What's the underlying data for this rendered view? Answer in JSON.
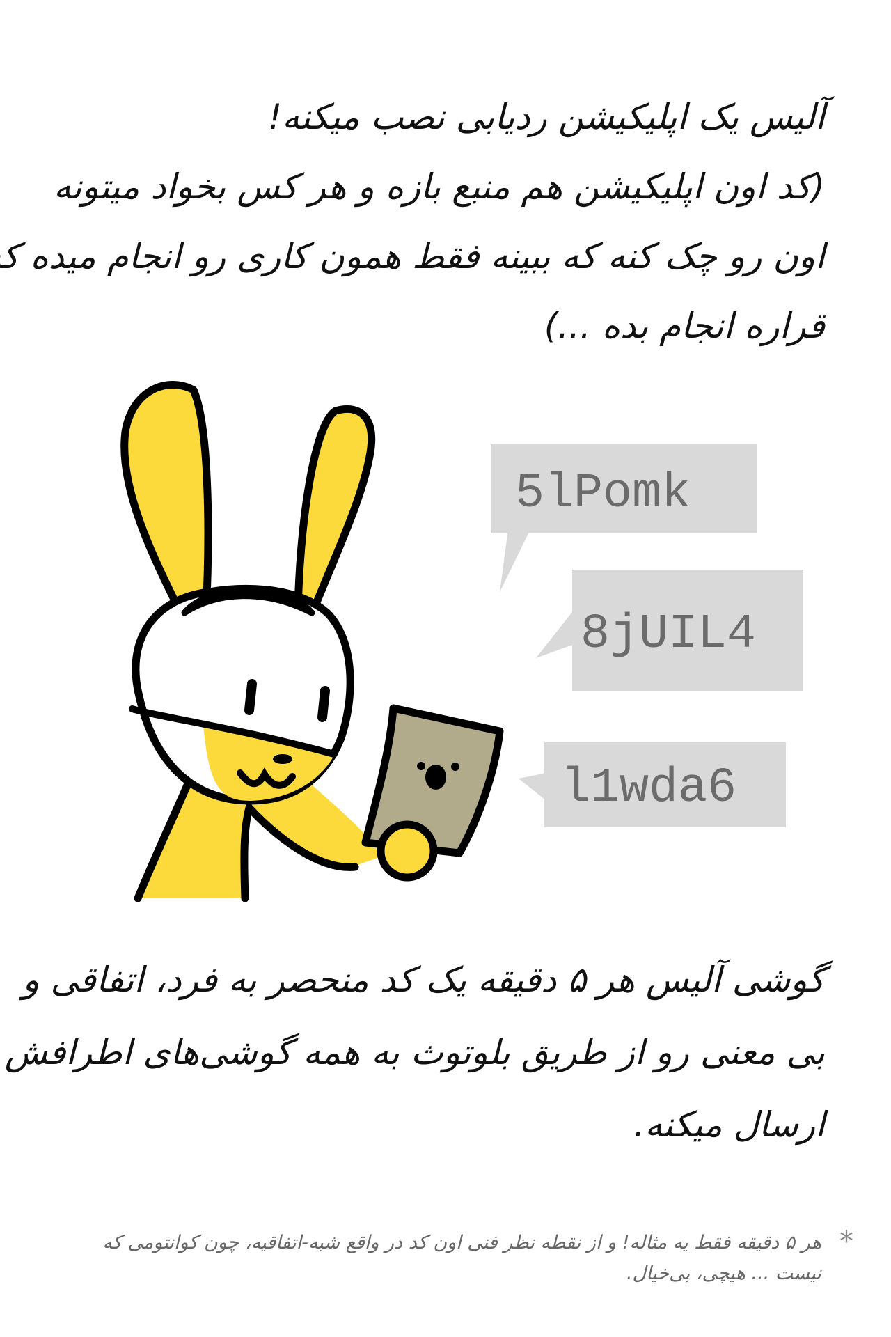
{
  "intro": {
    "lines": [
      "آلیس یک اپلیکیشن ردیابی نصب میکنه!",
      "(کد اون اپلیکیشن هم منبع بازه و هر کس بخواد میتونه",
      "اون رو چک کنه که ببینه فقط همون کاری رو انجام میده که",
      "قراره انجام بده ...)"
    ]
  },
  "codes": [
    "5lPomk",
    "8jUIL4",
    "l1wda6"
  ],
  "body": {
    "lines": [
      "گوشی آلیس هر ۵ دقیقه یک کد منحصر به فرد، اتفاقی و",
      "بی معنی رو از طریق بلوتوث به همه گوشی‌های اطرافش",
      "ارسال میکنه."
    ]
  },
  "footnote": {
    "asterisk": "*",
    "lines": [
      "هر ۵ دقیقه فقط یه مثاله! و از نقطه نظر فنی اون کد در واقع شبه-اتفاقیه، چون کوانتومی که",
      "نیست ... هیچی، بی‌خیال."
    ]
  },
  "colors": {
    "bunny_yellow": "#FDDA3B",
    "phone_body": "#B1AA8B",
    "bubble_gray": "#D9D9D9",
    "code_gray": "#6B6B6B",
    "outline": "#000000"
  }
}
